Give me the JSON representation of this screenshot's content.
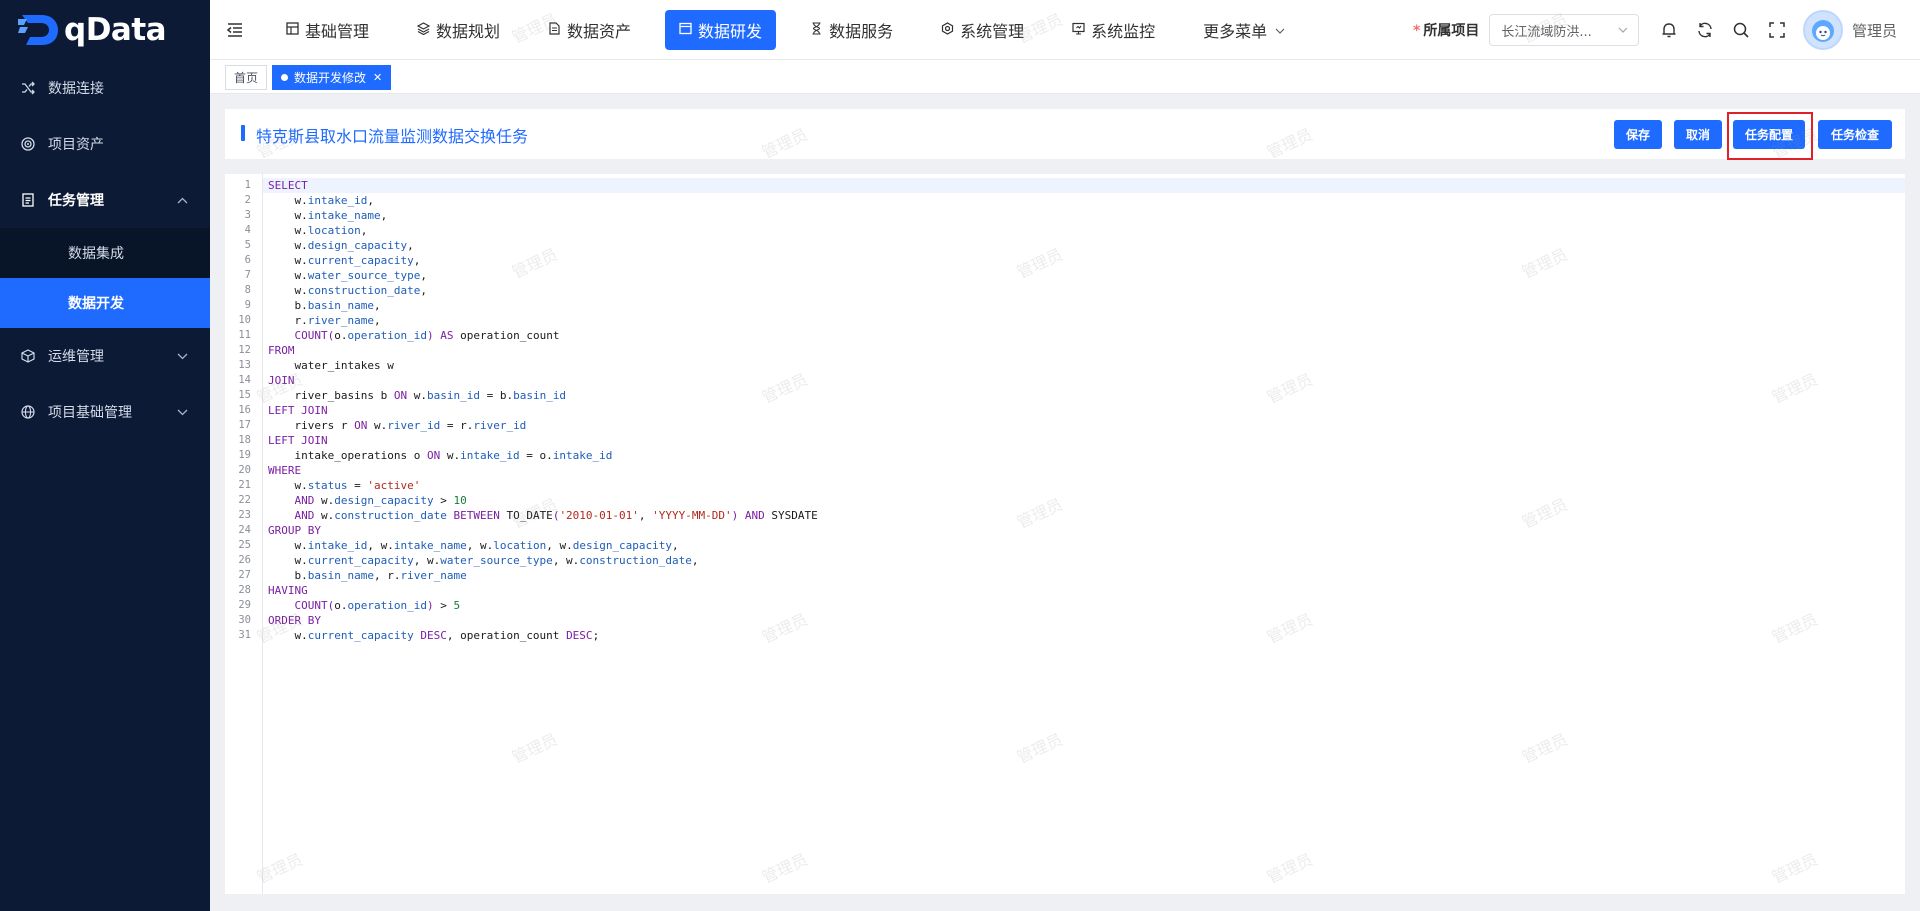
{
  "app": {
    "name": "qData"
  },
  "sidebar": {
    "items": [
      {
        "label": "数据连接",
        "icon": "shuffle-icon"
      },
      {
        "label": "项目资产",
        "icon": "target-icon"
      },
      {
        "label": "任务管理",
        "icon": "document-icon",
        "expanded": true,
        "children": [
          {
            "label": "数据集成"
          },
          {
            "label": "数据开发",
            "active": true
          }
        ]
      },
      {
        "label": "运维管理",
        "icon": "cube-icon"
      },
      {
        "label": "项目基础管理",
        "icon": "globe-icon"
      }
    ]
  },
  "topnav": {
    "items": [
      {
        "label": "基础管理",
        "icon": "grid-icon"
      },
      {
        "label": "数据规划",
        "icon": "layers-icon"
      },
      {
        "label": "数据资产",
        "icon": "file-icon"
      },
      {
        "label": "数据研发",
        "icon": "window-icon",
        "active": true
      },
      {
        "label": "数据服务",
        "icon": "hourglass-icon"
      },
      {
        "label": "系统管理",
        "icon": "settings-icon"
      },
      {
        "label": "系统监控",
        "icon": "monitor-icon"
      },
      {
        "label": "更多菜单",
        "icon": "chevron-down-icon"
      }
    ],
    "project_label": "所属项目",
    "project_required_mark": "*",
    "project_value": "长江流域防洪...",
    "username": "管理员"
  },
  "tags": {
    "home": "首页",
    "active": "数据开发修改"
  },
  "page": {
    "title": "特克斯县取水口流量监测数据交换任务",
    "buttons": {
      "save": "保存",
      "cancel": "取消",
      "config": "任务配置",
      "check": "任务检查"
    }
  },
  "editor": {
    "lines": [
      "SELECT",
      "    w.intake_id,",
      "    w.intake_name,",
      "    w.location,",
      "    w.design_capacity,",
      "    w.current_capacity,",
      "    w.water_source_type,",
      "    w.construction_date,",
      "    b.basin_name,",
      "    r.river_name,",
      "    COUNT(o.operation_id) AS operation_count",
      "FROM",
      "    water_intakes w",
      "JOIN",
      "    river_basins b ON w.basin_id = b.basin_id",
      "LEFT JOIN",
      "    rivers r ON w.river_id = r.river_id",
      "LEFT JOIN",
      "    intake_operations o ON w.intake_id = o.intake_id",
      "WHERE",
      "    w.status = 'active'",
      "    AND w.design_capacity > 10",
      "    AND w.construction_date BETWEEN TO_DATE('2010-01-01', 'YYYY-MM-DD') AND SYSDATE",
      "GROUP BY",
      "    w.intake_id, w.intake_name, w.location, w.design_capacity,",
      "    w.current_capacity, w.water_source_type, w.construction_date,",
      "    b.basin_name, r.river_name",
      "HAVING",
      "    COUNT(o.operation_id) > 5",
      "ORDER BY",
      "    w.current_capacity DESC, operation_count DESC;"
    ]
  },
  "watermark": "管理员",
  "colors": {
    "primary": "#1f6bff",
    "sidebar": "#0c1a36",
    "highlight": "#e0212a"
  }
}
